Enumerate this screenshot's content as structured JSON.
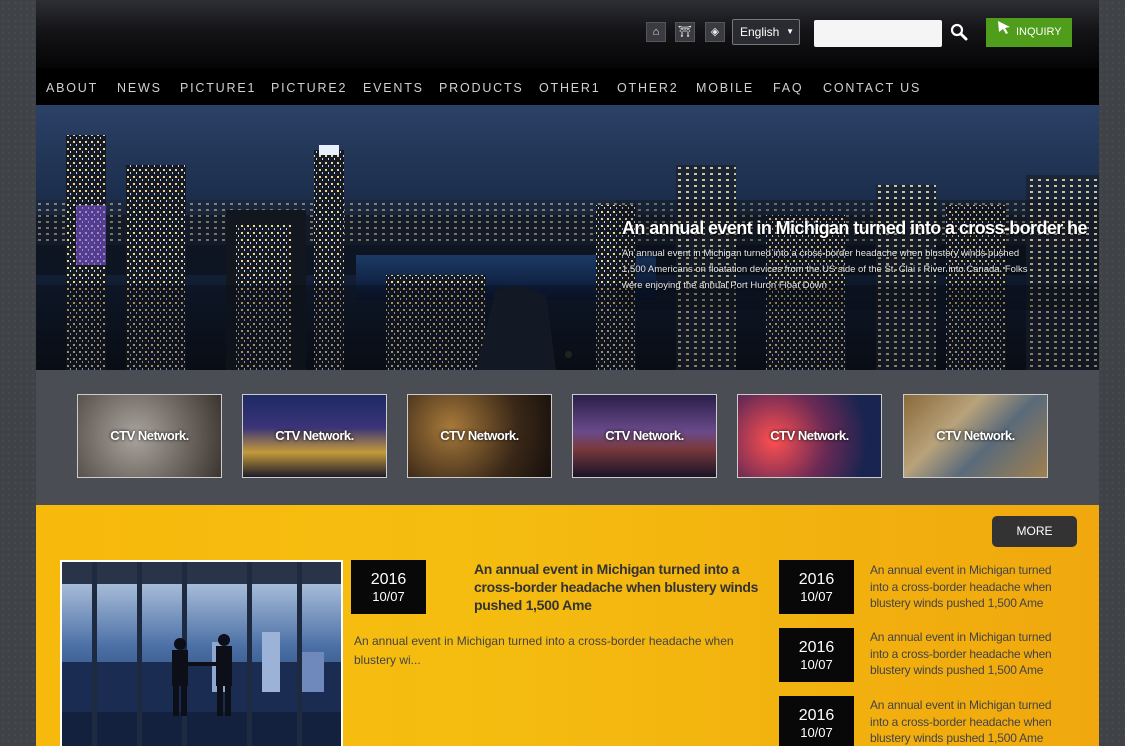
{
  "header": {
    "icons": [
      "home-icon",
      "sitemap-icon",
      "favorite-icon"
    ],
    "language": "English",
    "search_placeholder": "",
    "inquiry_label": "INQUIRY"
  },
  "nav": [
    "ABOUT",
    "NEWS",
    "PICTURE1",
    "PICTURE2",
    "EVENTS",
    "PRODUCTS",
    "OTHER1",
    "OTHER2",
    "MOBILE",
    "FAQ",
    "CONTACT US"
  ],
  "banner": {
    "title": "An annual event in Michigan turned into a cross-border he",
    "text": "An annual event in Michigan turned into a cross-border headache when blustery winds pushed 1,500 Americans on floatation devices from the US side of the St. Clai r River into Canada. Folks were enjoying the annual Port Huron Float Down"
  },
  "thumbnails": [
    "CTV Network.",
    "CTV Network.",
    "CTV Network.",
    "CTV Network.",
    "CTV Network.",
    "CTV Network."
  ],
  "news": {
    "more_label": "MORE",
    "feature": {
      "year": "2016",
      "date": "10/07",
      "title": "An annual event in Michigan turned into a cross-border headache when blustery winds pushed 1,500 Ame",
      "text": "An annual event in Michigan turned into a cross-border headache when blustery wi..."
    },
    "side_items": [
      {
        "year": "2016",
        "date": "10/07",
        "text": "An annual event in Michigan turned into a cross-border headache when blustery winds pushed 1,500 Ame"
      },
      {
        "year": "2016",
        "date": "10/07",
        "text": "An annual event in Michigan turned into a cross-border headache when blustery winds pushed 1,500 Ame"
      },
      {
        "year": "2016",
        "date": "10/07",
        "text": "An annual event in Michigan turned into a cross-border headache when blustery winds pushed 1,500 Ame"
      }
    ]
  },
  "colors": {
    "accent_yellow": "#f5b80c",
    "inquiry_green": "#4f9d1a",
    "nav_bg": "#000000"
  }
}
